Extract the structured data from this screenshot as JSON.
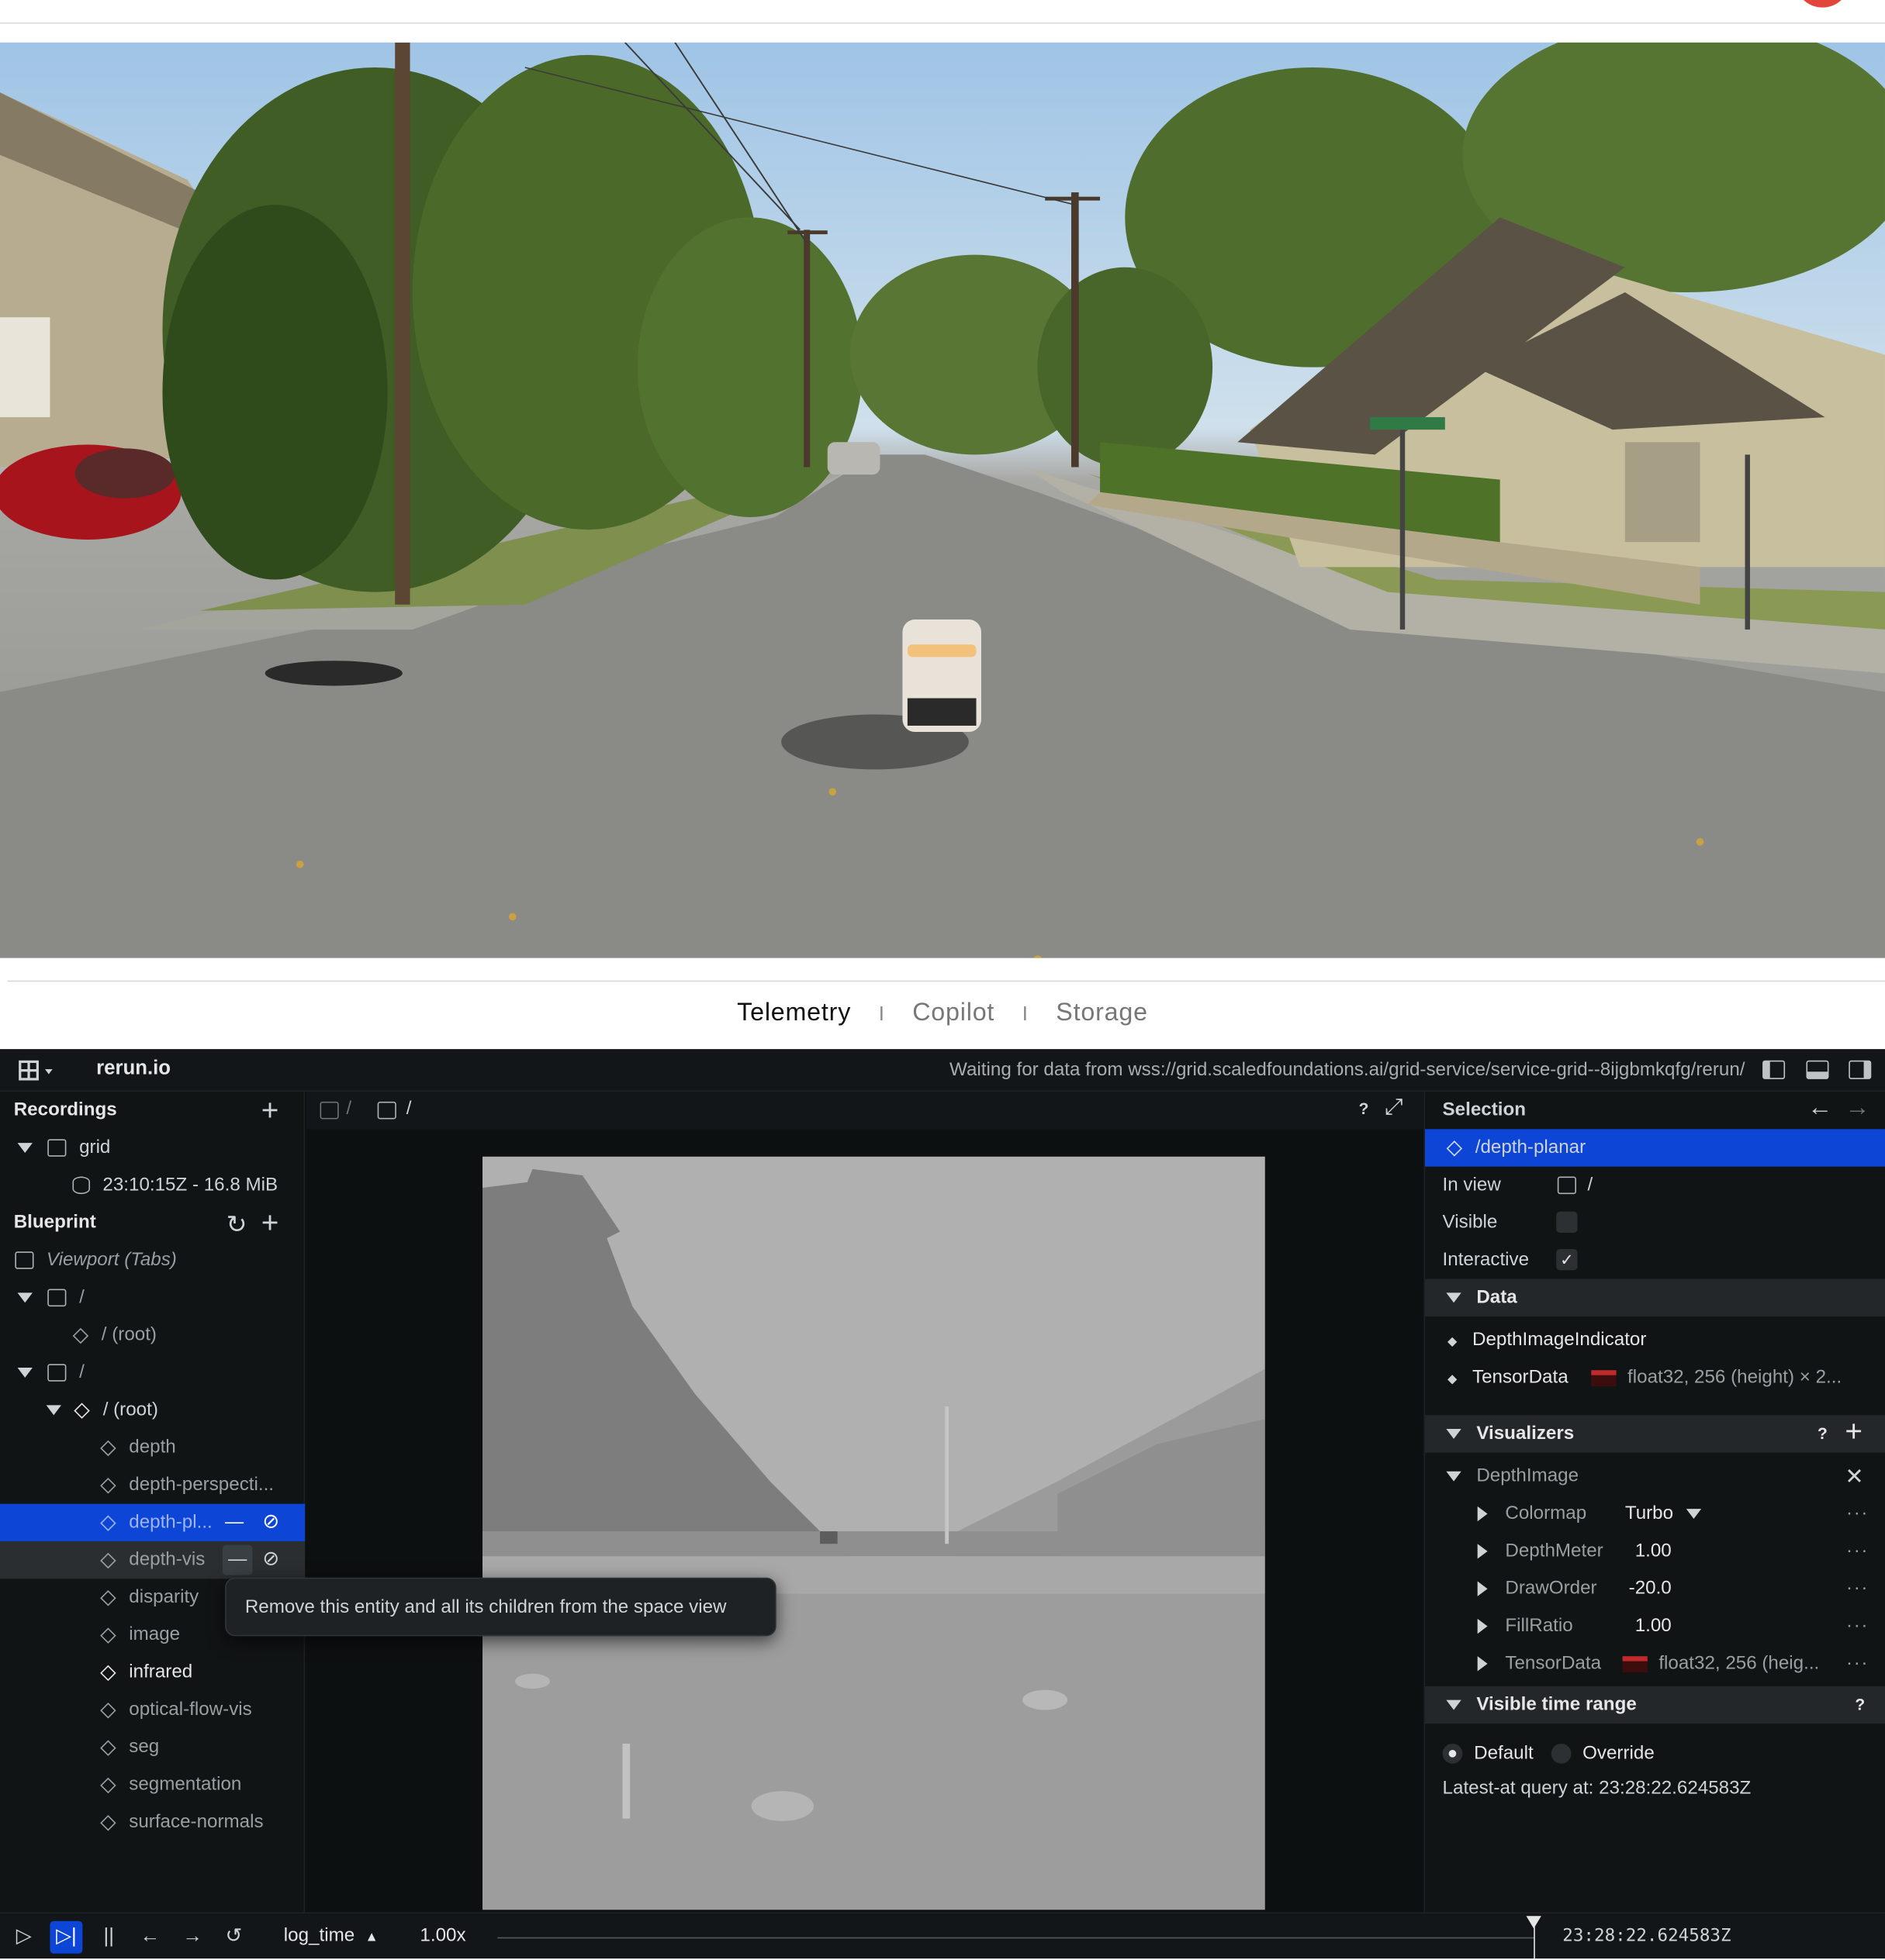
{
  "tabs": [
    {
      "label": "Telemetry"
    },
    {
      "label": "Copilot"
    },
    {
      "label": "Storage"
    }
  ],
  "tab_separator": "I",
  "viewer": {
    "app_name": "rerun.io",
    "status": "Waiting for data from wss://grid.scaledfoundations.ai/grid-service/service-grid--8ijgbmkqfg/rerun/",
    "left": {
      "recordings_label": "Recordings",
      "recording_name": "grid",
      "recording_info": "23:10:15Z - 16.8 MiB",
      "blueprint_label": "Blueprint",
      "viewport_label": "Viewport (Tabs)",
      "space_view_1": "/",
      "root_1": "/ (root)",
      "space_view_2": "/",
      "root_2": "/ (root)",
      "entities": [
        "depth",
        "depth-perspecti...",
        "depth-pl...",
        "depth-vis",
        "disparity",
        "image",
        "infrared",
        "optical-flow-vis",
        "seg",
        "segmentation",
        "surface-normals"
      ],
      "remove_label": "—",
      "tooltip": "Remove this entity and all its children from the space view"
    },
    "center": {
      "breadcrumb_1": "/",
      "breadcrumb_2": "/",
      "help": "?"
    },
    "right": {
      "selection_label": "Selection",
      "selected_path": "/depth-planar",
      "in_view_label": "In view",
      "in_view_value": "/",
      "visible_label": "Visible",
      "visible": false,
      "interactive_label": "Interactive",
      "interactive": true,
      "data_label": "Data",
      "data_items": [
        {
          "name": "DepthImageIndicator",
          "value": ""
        },
        {
          "name": "TensorData",
          "value": "float32, 256 (height) × 2..."
        }
      ],
      "visualizers_label": "Visualizers",
      "visualizer_name": "DepthImage",
      "properties": [
        {
          "name": "Colormap",
          "value": "Turbo"
        },
        {
          "name": "DepthMeter",
          "value": "1.00"
        },
        {
          "name": "DrawOrder",
          "value": "-20.0"
        },
        {
          "name": "FillRatio",
          "value": "1.00"
        },
        {
          "name": "TensorData",
          "value": "float32, 256 (heig..."
        }
      ],
      "more": "···",
      "time_range_label": "Visible time range",
      "default_label": "Default",
      "override_label": "Override",
      "latest_at": "Latest-at query at: 23:28:22.624583Z",
      "help": "?"
    },
    "bottom": {
      "timeline_name": "log_time",
      "speed": "1.00x",
      "time": "23:28:22.624583Z"
    }
  },
  "colors": {
    "selection": "#0d45d6",
    "viewer_bg": "#0d1011",
    "avatar": "#e2453a"
  }
}
